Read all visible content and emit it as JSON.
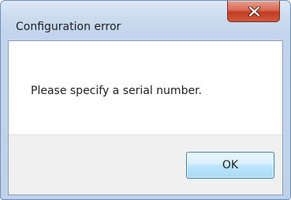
{
  "dialog": {
    "title": "Configuration error",
    "message": "Please specify a serial number.",
    "ok_label": "OK",
    "close_icon": "close-icon"
  },
  "colors": {
    "close_button": "#c23b22",
    "ok_button_border": "#3c7fb1",
    "frame": "#bed2ea",
    "footer": "#f0f0f0"
  }
}
